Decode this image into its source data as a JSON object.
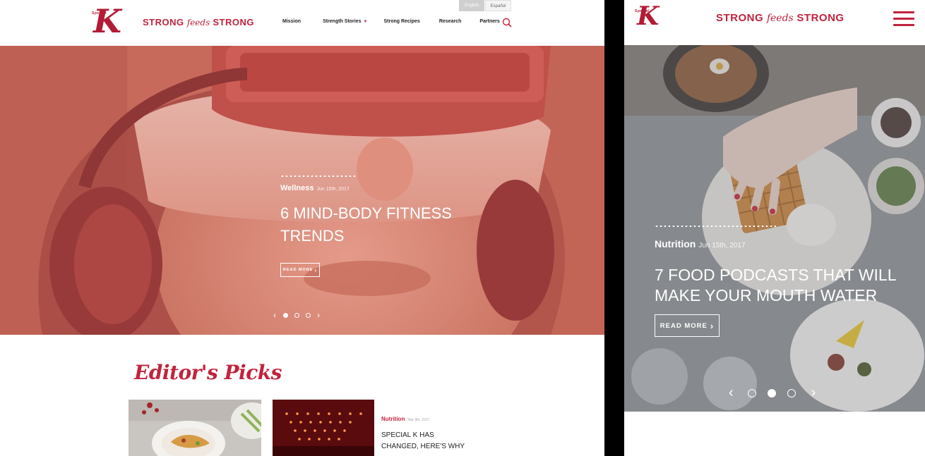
{
  "brand": {
    "logo_letter": "K",
    "logo_small": "Special",
    "name_left": "STRONG",
    "name_mid": "feeds",
    "name_right": "STRONG"
  },
  "desktop": {
    "language": {
      "english": "English",
      "spanish": "Español"
    },
    "nav": [
      {
        "label": "Mission"
      },
      {
        "label": "Strength Stories",
        "has_dropdown": true
      },
      {
        "label": "Strong Recipes"
      },
      {
        "label": "Research"
      },
      {
        "label": "Partners"
      }
    ],
    "hero": {
      "category": "Wellness",
      "date": "Jun 15th, 2017",
      "title_line1": "6 MIND-BODY FITNESS",
      "title_line2": "TRENDS",
      "cta": "READ MORE",
      "slide_count": 3,
      "active_slide": 1
    },
    "editors_picks": {
      "heading": "Editor's Picks",
      "card": {
        "category": "Nutrition",
        "date": "Mar 9th, 2017",
        "title": "SPECIAL K HAS CHANGED, HERE'S WHY"
      }
    }
  },
  "mobile": {
    "hero": {
      "category": "Nutrition",
      "date": "Jun 15th, 2017",
      "title_line1": "7 FOOD PODCASTS THAT WILL",
      "title_line2": "MAKE YOUR MOUTH WATER",
      "cta": "READ MORE",
      "slide_count": 3,
      "active_slide": 2
    }
  },
  "colors": {
    "brand_red": "#c0233d",
    "hero_tint": "#d48371"
  },
  "icons": [
    "search-icon",
    "hamburger-menu-icon",
    "chevron-left-icon",
    "chevron-right-icon",
    "dropdown-caret-icon"
  ]
}
